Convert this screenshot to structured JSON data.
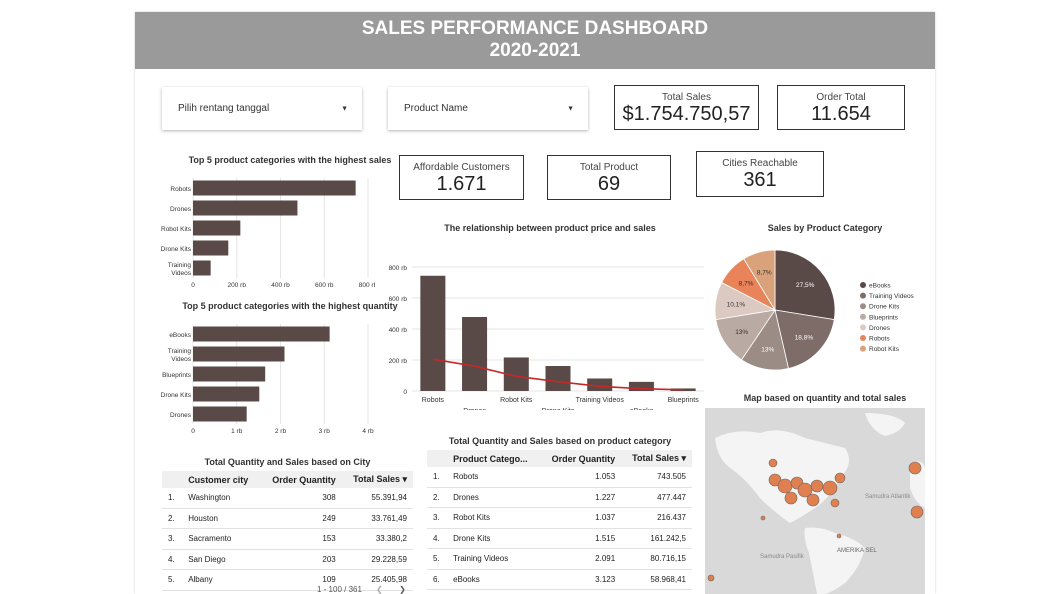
{
  "header": {
    "title_line1": "SALES PERFORMANCE DASHBOARD",
    "title_line2": "2020-2021"
  },
  "filters": {
    "date_range": "Pilih rentang tanggal",
    "product_name": "Product Name"
  },
  "kpis": {
    "total_sales": {
      "label": "Total Sales",
      "value": "$1.754.750,57"
    },
    "order_total": {
      "label": "Order Total",
      "value": "11.654"
    },
    "affordable_customers": {
      "label": "Affordable Customers",
      "value": "1.671"
    },
    "total_product": {
      "label": "Total Product",
      "value": "69"
    },
    "cities_reachable": {
      "label": "Cities Reachable",
      "value": "361"
    }
  },
  "colors": {
    "bar": "#5a4a47",
    "line": "#c62828",
    "header_bg": "#9a9a9a"
  },
  "chart_data": [
    {
      "type": "bar",
      "orientation": "horizontal",
      "title": "Top 5 product categories with the highest sales",
      "categories": [
        "Robots",
        "Drones",
        "Robot Kits",
        "Drone Kits",
        "Training Videos"
      ],
      "values": [
        743505,
        477447,
        216437,
        161242,
        80716
      ],
      "tick_labels": [
        "0",
        "200 rb",
        "400 rb",
        "600 rb",
        "800 rb"
      ],
      "xlim": [
        0,
        800000
      ],
      "grid": true
    },
    {
      "type": "bar",
      "orientation": "horizontal",
      "title": "Top 5 product categories with the highest quantity",
      "categories": [
        "eBooks",
        "Training Videos",
        "Blueprints",
        "Drone Kits",
        "Drones"
      ],
      "values": [
        3123,
        2091,
        1650,
        1515,
        1227
      ],
      "tick_labels": [
        "0",
        "1 rb",
        "2 rb",
        "3 rb",
        "4 rb"
      ],
      "xlim": [
        0,
        4000
      ],
      "grid": true
    },
    {
      "type": "bar",
      "title": "The relationship between product price and sales",
      "categories": [
        "Robots",
        "Drones",
        "Robot Kits",
        "Drone Kits",
        "Training Videos",
        "eBooks",
        "Blueprints"
      ],
      "series": [
        {
          "kind": "bar",
          "values": [
            743505,
            477447,
            216437,
            161242,
            80716,
            58968,
            16500
          ]
        },
        {
          "kind": "line",
          "values": [
            205000,
            160000,
            95000,
            60000,
            30000,
            15000,
            8000
          ]
        }
      ],
      "tick_labels": [
        "0",
        "200 rb",
        "400 rb",
        "600 rb",
        "800 rb"
      ],
      "ylim": [
        0,
        800000
      ],
      "grid": true
    },
    {
      "type": "pie",
      "title": "Sales by Product Category",
      "labels": [
        "eBooks",
        "Training Videos",
        "Drone Kits",
        "Blueprints",
        "Drones",
        "Robots",
        "Robot Kits"
      ],
      "values": [
        27.5,
        18.8,
        13,
        13,
        10.1,
        8.7,
        8.7
      ],
      "slice_labels": [
        "27,5%",
        "18,8%",
        "13%",
        "13%",
        "10,1%",
        "8,7%",
        "8,7%"
      ],
      "colors": [
        "#5a4a47",
        "#7d6c67",
        "#9c8c86",
        "#b9aaa4",
        "#dccac2",
        "#e8835a",
        "#d9a27a"
      ],
      "legend_position": "right"
    }
  ],
  "map": {
    "title": "Map based on quantity and total sales",
    "labels": [
      "Samudra Atlantik",
      "AMERIKA SEL",
      "Samudra Pasifik"
    ]
  },
  "city_table": {
    "title": "Total Quantity and Sales based on City",
    "columns": [
      "",
      "Customer city",
      "Order Quantity",
      "Total Sales ▾"
    ],
    "rows": [
      [
        "1.",
        "Washington",
        "308",
        "55.391,94"
      ],
      [
        "2.",
        "Houston",
        "249",
        "33.761,49"
      ],
      [
        "3.",
        "Sacramento",
        "153",
        "33.380,2"
      ],
      [
        "4.",
        "San Diego",
        "203",
        "29.228,59"
      ],
      [
        "5.",
        "Albany",
        "109",
        "25.405,98"
      ]
    ],
    "pager": "1 - 100 / 361"
  },
  "category_table": {
    "title": "Total Quantity and Sales based on product category",
    "columns": [
      "",
      "Product Catego...",
      "Order Quantity",
      "Total Sales ▾"
    ],
    "rows": [
      [
        "1.",
        "Robots",
        "1.053",
        "743.505"
      ],
      [
        "2.",
        "Drones",
        "1.227",
        "477.447"
      ],
      [
        "3.",
        "Robot Kits",
        "1.037",
        "216.437"
      ],
      [
        "4.",
        "Drone Kits",
        "1.515",
        "161.242,5"
      ],
      [
        "5.",
        "Training Videos",
        "2.091",
        "80.716,15"
      ],
      [
        "6.",
        "eBooks",
        "3.123",
        "58.968,41"
      ]
    ]
  }
}
